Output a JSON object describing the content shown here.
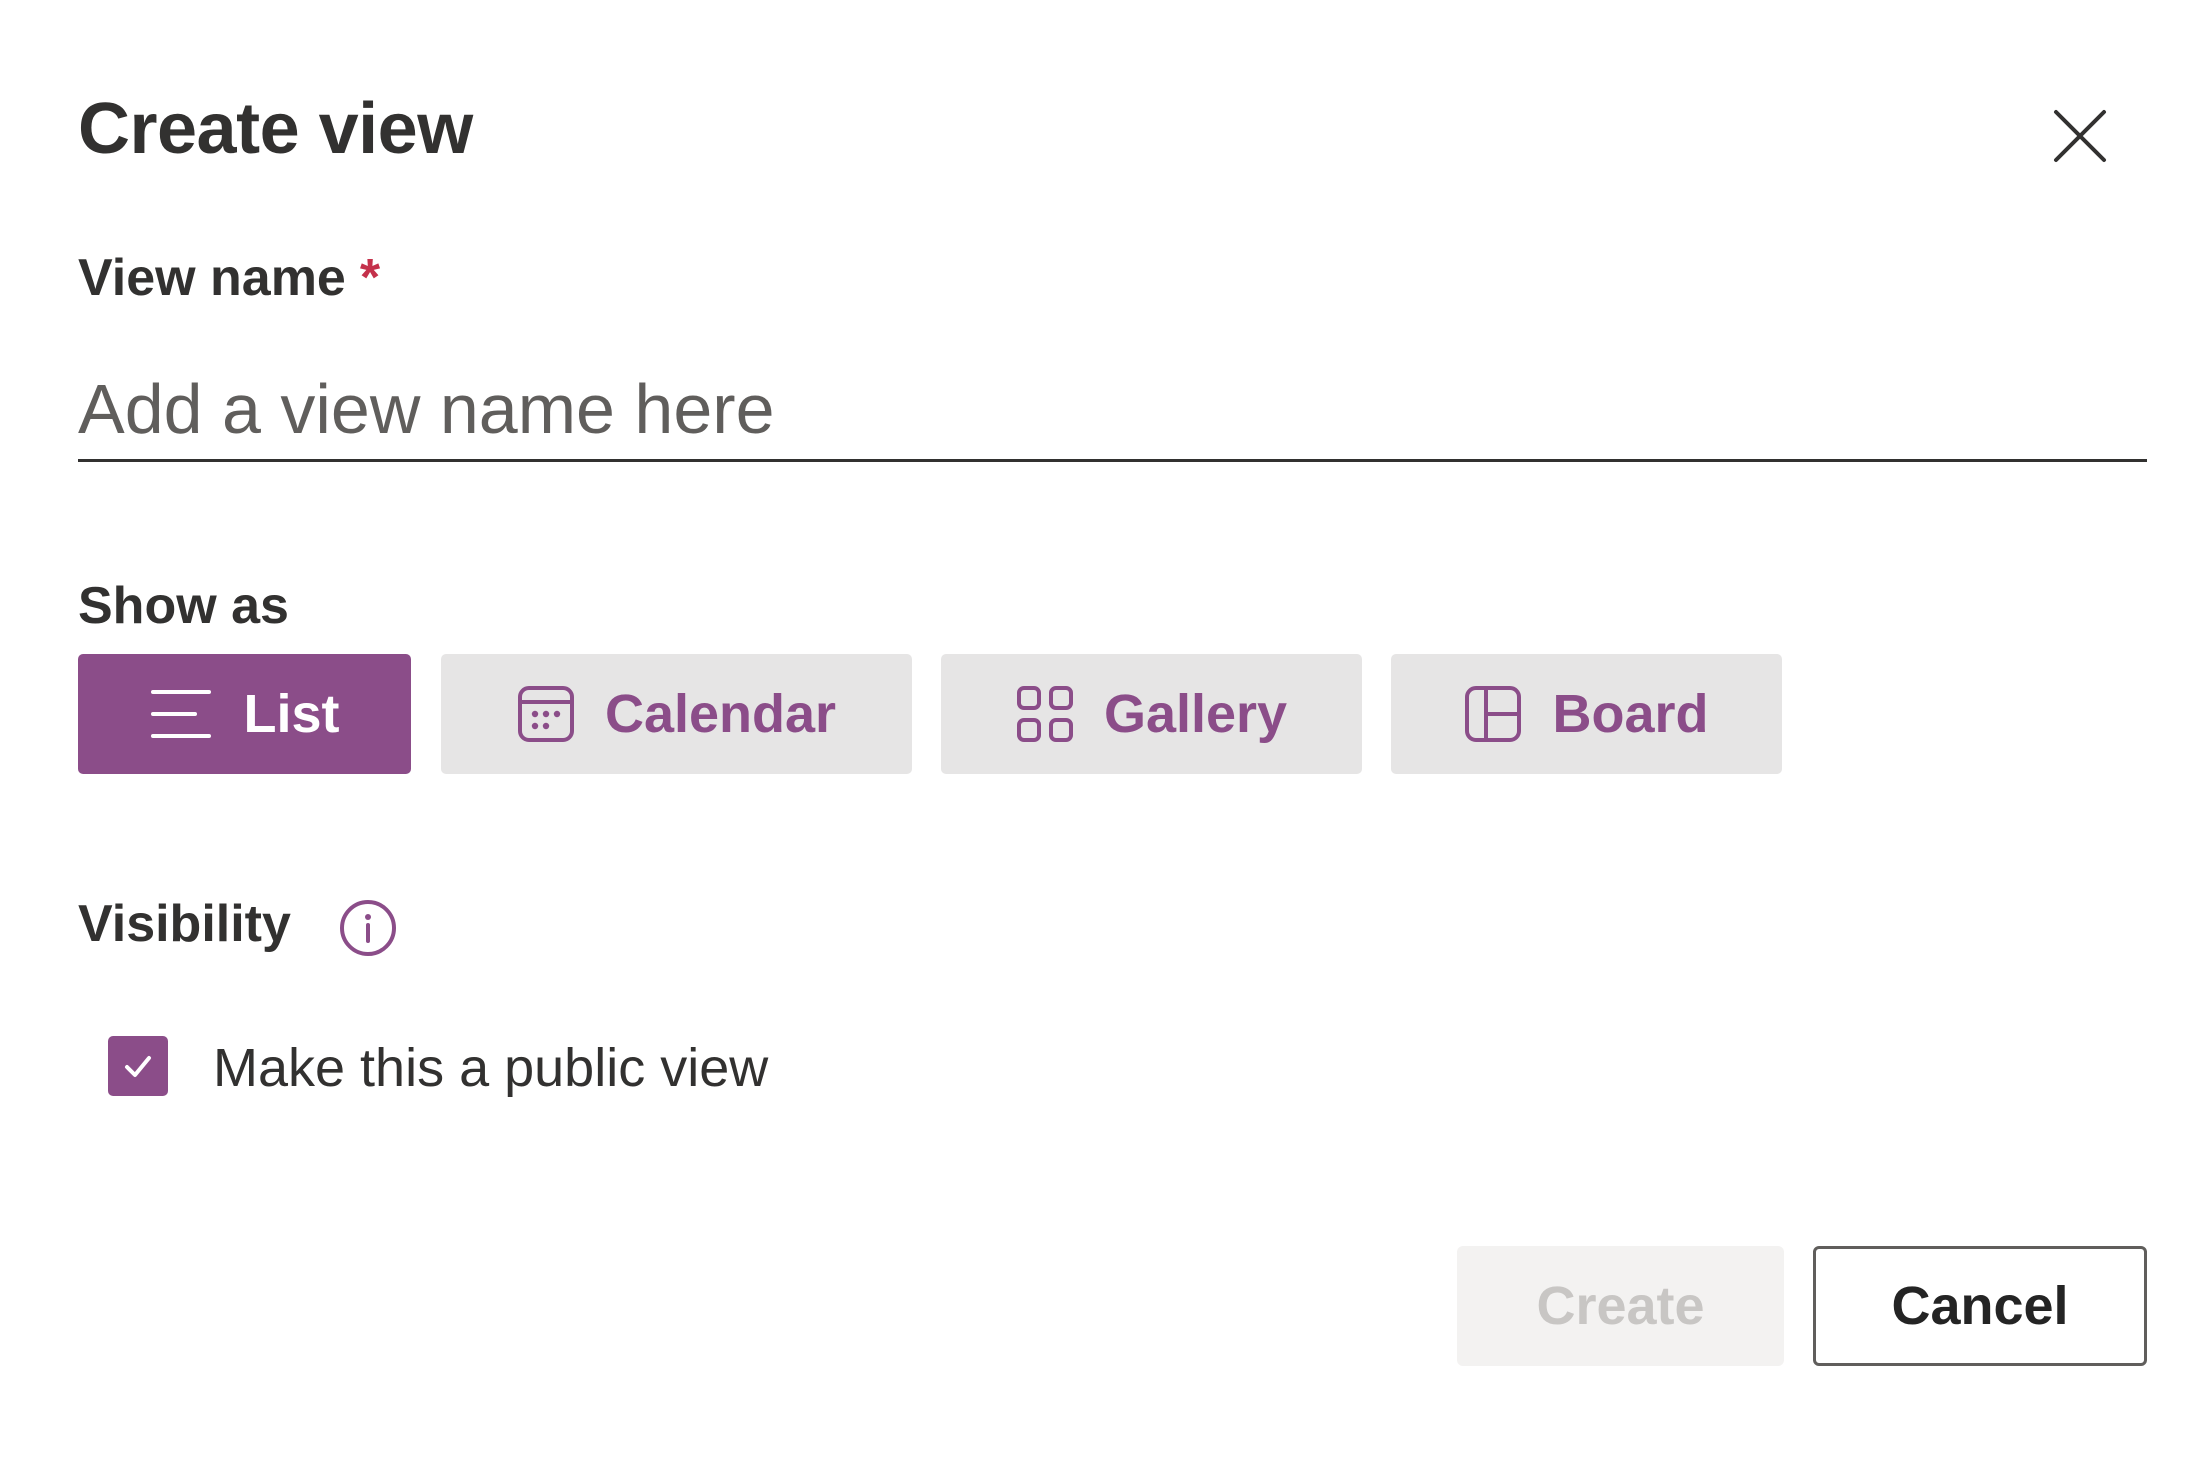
{
  "dialog": {
    "title": "Create view",
    "close_icon": "close-icon"
  },
  "view_name": {
    "label": "View name",
    "required_marker": "*",
    "value": "",
    "placeholder": "Add a view name here"
  },
  "show_as": {
    "label": "Show as",
    "selected": "List",
    "options": [
      {
        "label": "List",
        "icon": "list-icon",
        "selected": true
      },
      {
        "label": "Calendar",
        "icon": "calendar-icon",
        "selected": false
      },
      {
        "label": "Gallery",
        "icon": "gallery-grid-icon",
        "selected": false
      },
      {
        "label": "Board",
        "icon": "board-icon",
        "selected": false
      }
    ]
  },
  "visibility": {
    "label": "Visibility",
    "info_icon": "info-icon",
    "public_checkbox": {
      "label": "Make this a public view",
      "checked": true
    }
  },
  "footer": {
    "create_label": "Create",
    "create_disabled": true,
    "cancel_label": "Cancel"
  },
  "colors": {
    "accent": "#8b4d89",
    "required": "#c4314b",
    "unselected_button_bg": "#e6e5e5",
    "disabled_button_bg": "#f3f2f1",
    "disabled_text": "#c8c6c4"
  }
}
